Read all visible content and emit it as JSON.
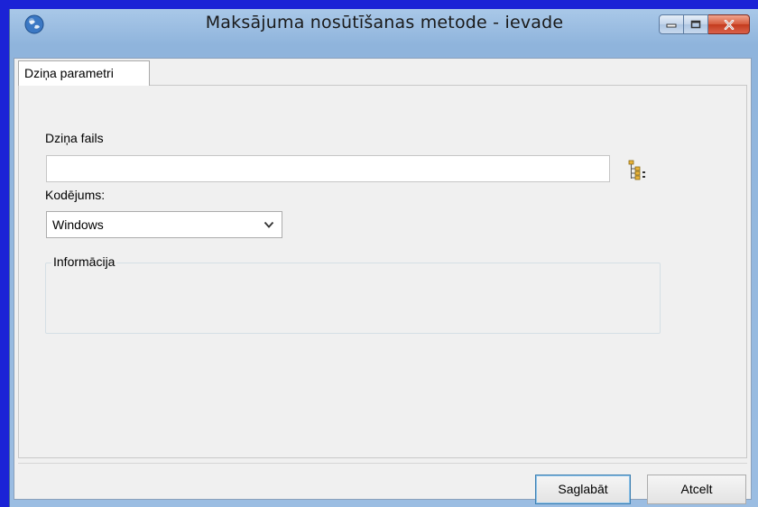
{
  "window": {
    "title": "Maksājuma nosūtīšanas metode - ievade"
  },
  "caption_buttons": {
    "minimize_icon": "minimize-icon",
    "maximize_icon": "maximize-icon",
    "close_icon": "close-icon"
  },
  "tabs": [
    {
      "label": "Dziņa parametri",
      "active": true
    }
  ],
  "form": {
    "file_label": "Dziņa fails",
    "file_value": "",
    "encoding_label": "Kodējums:",
    "encoding_value": "Windows",
    "info_group_title": "Informācija"
  },
  "buttons": {
    "save": "Saglabāt",
    "cancel": "Atcelt"
  },
  "colors": {
    "close_button": "#c43b1d",
    "primary_button_border": "#3c7fb1"
  }
}
